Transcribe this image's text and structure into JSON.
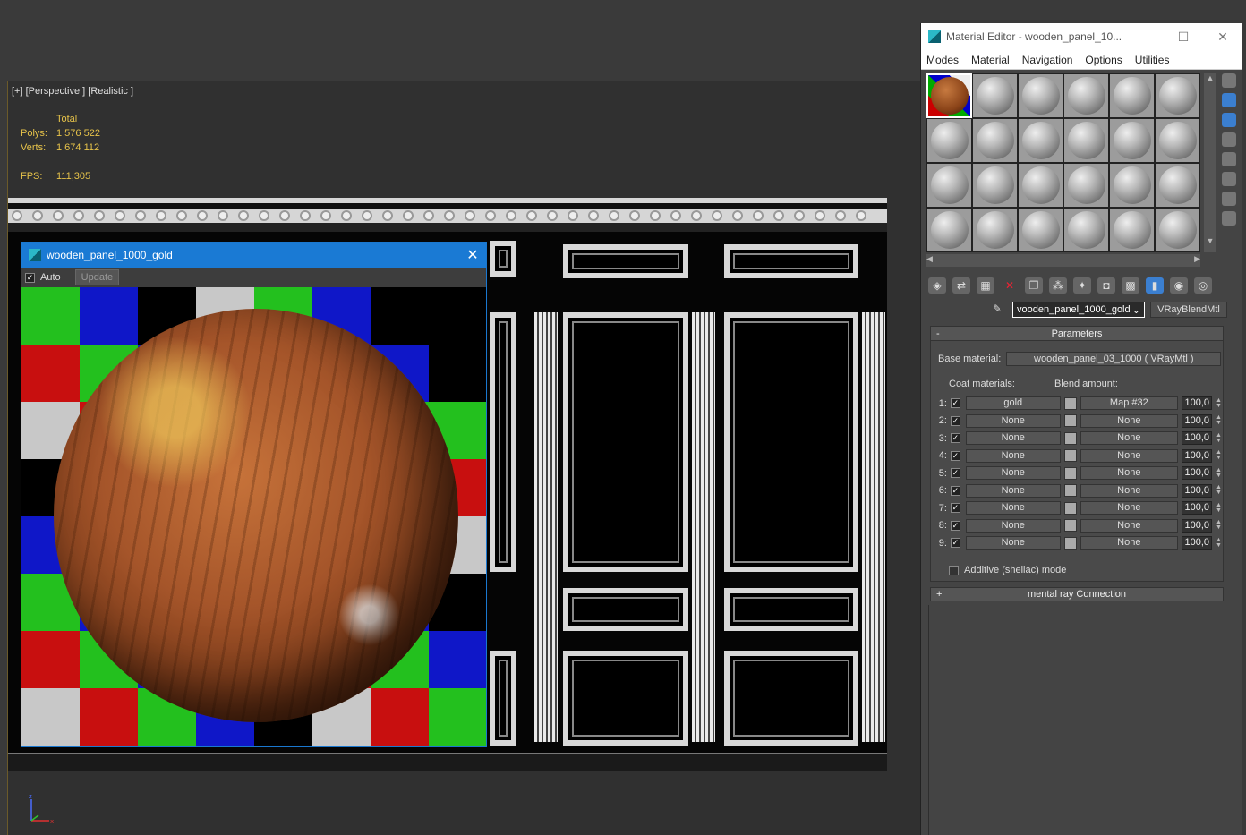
{
  "viewport": {
    "label": "[+] [Perspective ] [Realistic ]",
    "stats": {
      "header": "Total",
      "polys_label": "Polys:",
      "polys_value": "1 576 522",
      "verts_label": "Verts:",
      "verts_value": "1 674 112",
      "fps_label": "FPS:",
      "fps_value": "111,305"
    }
  },
  "preview": {
    "title": "wooden_panel_1000_gold",
    "auto_label": "Auto",
    "auto_checked": true,
    "update_label": "Update",
    "checker_colors": [
      "#23c01e",
      "#0f17c8",
      "#000000",
      "#c8c8c8",
      "#c80f0f"
    ]
  },
  "material_editor": {
    "title": "Material Editor - wooden_panel_10...",
    "menu": [
      "Modes",
      "Material",
      "Navigation",
      "Options",
      "Utilities"
    ],
    "material_name": "vooden_panel_1000_gold",
    "material_type": "VRayBlendMtl",
    "parameters": {
      "header": "Parameters",
      "base_material_label": "Base material:",
      "base_material_value": "wooden_panel_03_1000  ( VRayMtl )",
      "coat_header": "Coat materials:",
      "blend_header": "Blend amount:",
      "rows": [
        {
          "index": "1:",
          "material": "gold",
          "map": "Map #32",
          "amount": "100,0"
        },
        {
          "index": "2:",
          "material": "None",
          "map": "None",
          "amount": "100,0"
        },
        {
          "index": "3:",
          "material": "None",
          "map": "None",
          "amount": "100,0"
        },
        {
          "index": "4:",
          "material": "None",
          "map": "None",
          "amount": "100,0"
        },
        {
          "index": "5:",
          "material": "None",
          "map": "None",
          "amount": "100,0"
        },
        {
          "index": "6:",
          "material": "None",
          "map": "None",
          "amount": "100,0"
        },
        {
          "index": "7:",
          "material": "None",
          "map": "None",
          "amount": "100,0"
        },
        {
          "index": "8:",
          "material": "None",
          "map": "None",
          "amount": "100,0"
        },
        {
          "index": "9:",
          "material": "None",
          "map": "None",
          "amount": "100,0"
        }
      ],
      "additive_label": "Additive (shellac) mode"
    },
    "mental_ray_label": "mental ray Connection"
  }
}
